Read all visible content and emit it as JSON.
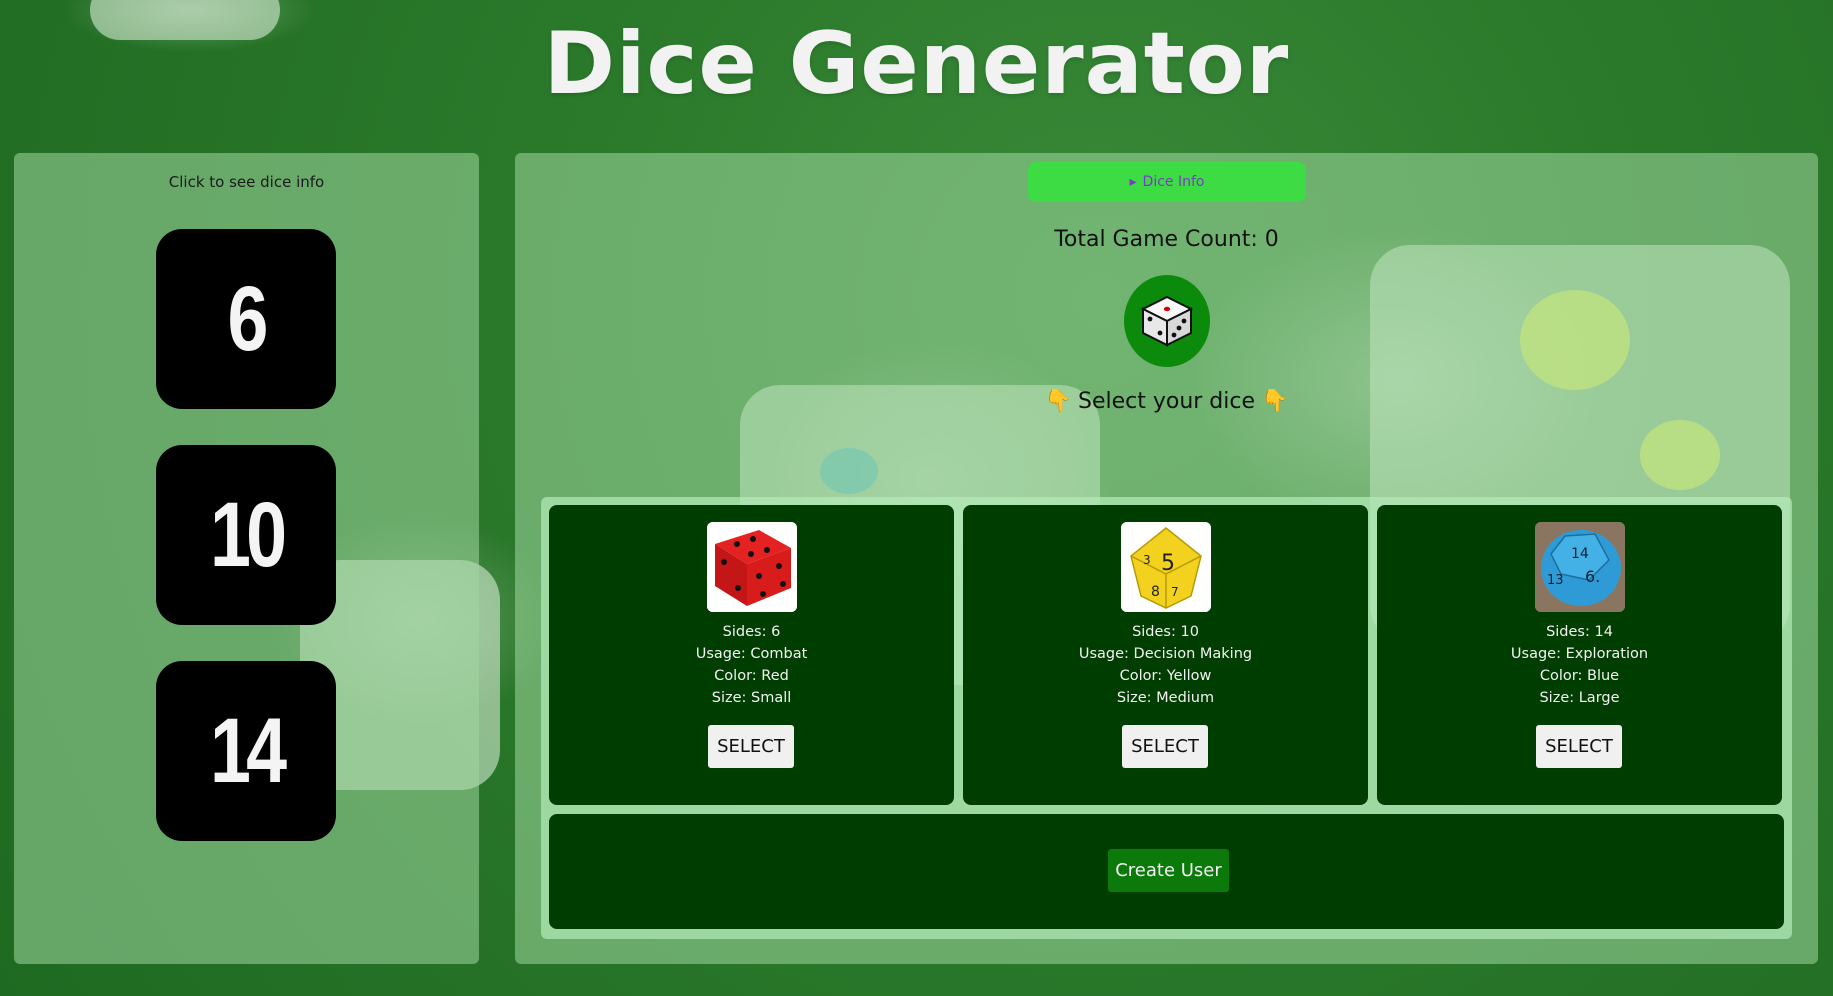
{
  "header": {
    "title": "Dice Generator"
  },
  "sidebar": {
    "caption": "Click to see dice info",
    "dice": [
      {
        "label": "6"
      },
      {
        "label": "10"
      },
      {
        "label": "14"
      }
    ]
  },
  "main": {
    "info_toggle_label": "Dice Info",
    "info_toggle_icon": "▸",
    "game_count_text": "Total Game Count: 0",
    "select_prompt": "Select your dice",
    "prompt_icon": "👇",
    "cards": [
      {
        "sides": "Sides: 6",
        "usage": "Usage: Combat",
        "color": "Color: Red",
        "size": "Size: Small",
        "select_label": "SELECT"
      },
      {
        "sides": "Sides: 10",
        "usage": "Usage: Decision Making",
        "color": "Color: Yellow",
        "size": "Size: Medium",
        "select_label": "SELECT"
      },
      {
        "sides": "Sides: 14",
        "usage": "Usage: Exploration",
        "color": "Color: Blue",
        "size": "Size: Large",
        "select_label": "SELECT"
      }
    ],
    "create_user_label": "Create User"
  },
  "colors": {
    "panel_dark": "#003d00",
    "toggle_green": "#3ddc44",
    "roll_green": "#0b8a0b",
    "toggle_text": "#7a3cc0"
  }
}
